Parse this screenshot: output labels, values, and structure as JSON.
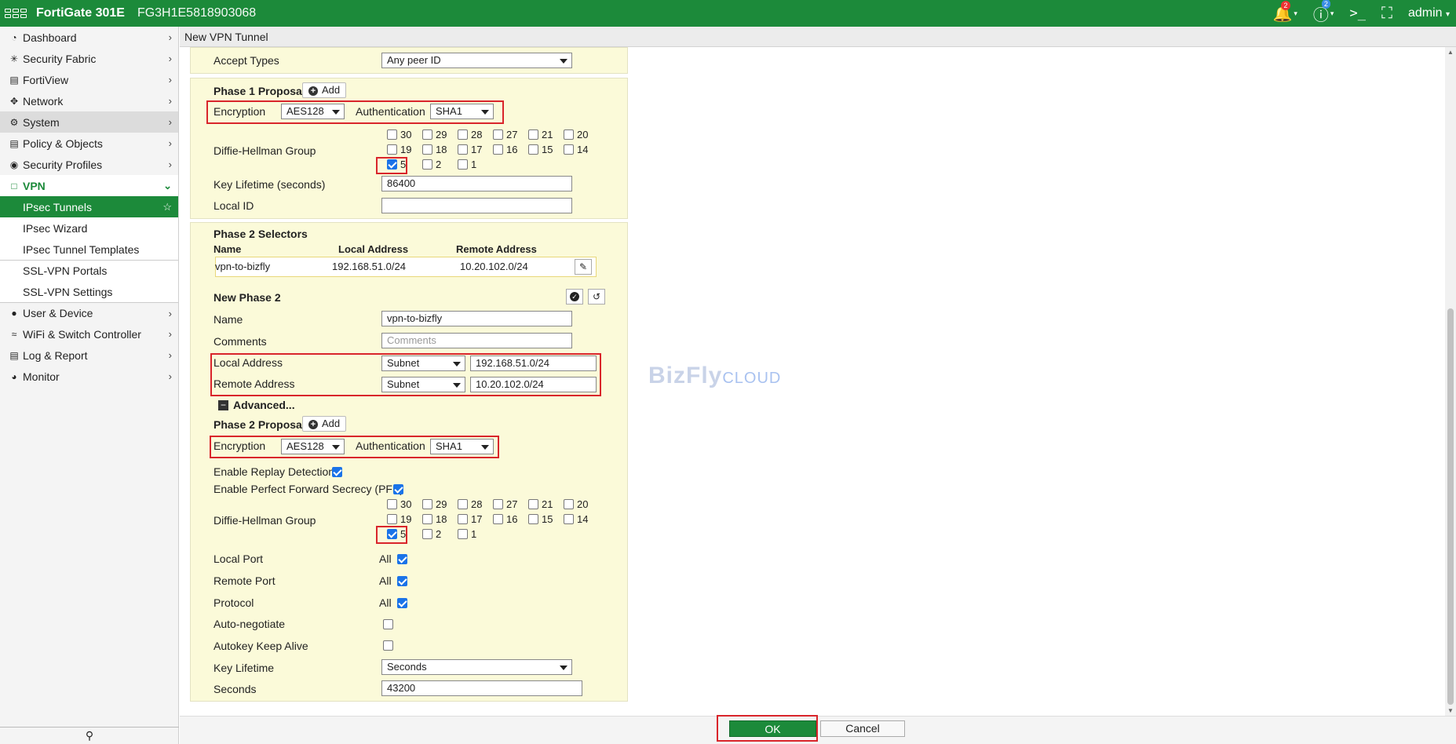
{
  "topbar": {
    "product": "FortiGate 301E",
    "serial": "FG3H1E5818903068",
    "alerts_count": "2",
    "help_count": "2",
    "user": "admin"
  },
  "sidebar": {
    "items": [
      {
        "label": "Dashboard",
        "icon": "dashboard-icon"
      },
      {
        "label": "Security Fabric",
        "icon": "fabric-icon"
      },
      {
        "label": "FortiView",
        "icon": "chart-icon"
      },
      {
        "label": "Network",
        "icon": "network-icon"
      },
      {
        "label": "System",
        "icon": "gear-icon"
      },
      {
        "label": "Policy & Objects",
        "icon": "policy-icon"
      },
      {
        "label": "Security Profiles",
        "icon": "lock-icon"
      },
      {
        "label": "VPN",
        "icon": "laptop-icon"
      },
      {
        "label": "IPsec Tunnels"
      },
      {
        "label": "IPsec Wizard"
      },
      {
        "label": "IPsec Tunnel Templates"
      },
      {
        "label": "SSL-VPN Portals"
      },
      {
        "label": "SSL-VPN Settings"
      },
      {
        "label": "User & Device",
        "icon": "user-icon"
      },
      {
        "label": "WiFi & Switch Controller",
        "icon": "wifi-icon"
      },
      {
        "label": "Log & Report",
        "icon": "report-icon"
      },
      {
        "label": "Monitor",
        "icon": "monitor-icon"
      }
    ]
  },
  "page": {
    "title": "New VPN Tunnel"
  },
  "phase1": {
    "accept_types_label": "Accept Types",
    "accept_types_value": "Any peer ID",
    "proposal_label": "Phase 1 Proposal",
    "add_label": "Add",
    "encryption_label": "Encryption",
    "encryption_value": "AES128",
    "auth_label": "Authentication",
    "auth_value": "SHA1",
    "dh_label": "Diffie-Hellman Group",
    "dh_groups": [
      "30",
      "29",
      "28",
      "27",
      "21",
      "20",
      "19",
      "18",
      "17",
      "16",
      "15",
      "14",
      "5",
      "2",
      "1"
    ],
    "dh_checked": [
      "5"
    ],
    "key_lifetime_label": "Key Lifetime (seconds)",
    "key_lifetime_value": "86400",
    "local_id_label": "Local ID",
    "local_id_value": ""
  },
  "phase2": {
    "selectors_label": "Phase 2 Selectors",
    "col_name": "Name",
    "col_local": "Local Address",
    "col_remote": "Remote Address",
    "row_name": "vpn-to-bizfly",
    "row_local": "192.168.51.0/24",
    "row_remote": "10.20.102.0/24",
    "new_label": "New Phase 2",
    "name_label": "Name",
    "name_value": "vpn-to-bizfly",
    "comments_label": "Comments",
    "comments_placeholder": "Comments",
    "local_addr_label": "Local Address",
    "local_addr_type": "Subnet",
    "local_addr_value": "192.168.51.0/24",
    "remote_addr_label": "Remote Address",
    "remote_addr_type": "Subnet",
    "remote_addr_value": "10.20.102.0/24",
    "advanced_label": "Advanced...",
    "proposal_label": "Phase 2 Proposal",
    "add_label": "Add",
    "encryption_label": "Encryption",
    "encryption_value": "AES128",
    "auth_label": "Authentication",
    "auth_value": "SHA1",
    "replay_label": "Enable Replay Detection",
    "pfs_label": "Enable Perfect Forward Secrecy (PFS)",
    "dh_label": "Diffie-Hellman Group",
    "local_port_label": "Local Port",
    "remote_port_label": "Remote Port",
    "protocol_label": "Protocol",
    "all_label": "All",
    "auto_negotiate_label": "Auto-negotiate",
    "keepalive_label": "Autokey Keep Alive",
    "key_lifetime_label": "Key Lifetime",
    "key_lifetime_type": "Seconds",
    "seconds_label": "Seconds",
    "seconds_value": "43200"
  },
  "watermark": {
    "text": "BizFly",
    "text2": "CLOUD"
  },
  "footer": {
    "ok_label": "OK",
    "cancel_label": "Cancel"
  }
}
